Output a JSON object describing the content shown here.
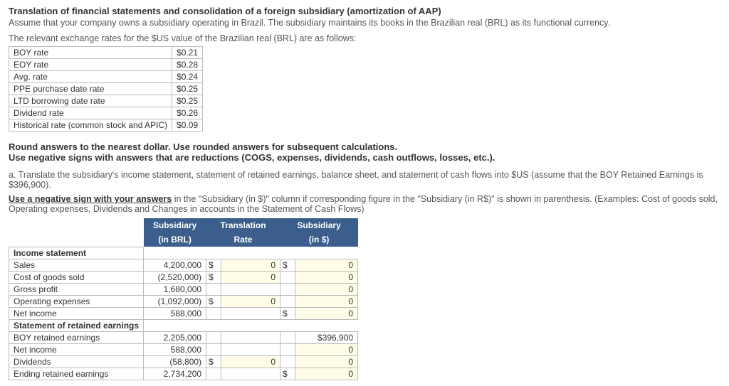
{
  "header": {
    "title": "Translation of financial statements and consolidation of a foreign subsidiary (amortization of AAP)",
    "intro": "Assume that your company owns a subsidiary operating in Brazil. The subsidiary maintains its books in the Brazilian real (BRL) as its functional currency.",
    "rates_lead": "The relevant exchange rates for the $US value of the Brazilian real (BRL) are as follows:"
  },
  "rates": [
    {
      "label": "BOY rate",
      "value": "$0.21"
    },
    {
      "label": "EOY rate",
      "value": "$0.28"
    },
    {
      "label": "Avg. rate",
      "value": "$0.24"
    },
    {
      "label": "PPE purchase date rate",
      "value": "$0.25"
    },
    {
      "label": "LTD borrowing date rate",
      "value": "$0.25"
    },
    {
      "label": "Dividend rate",
      "value": "$0.26"
    },
    {
      "label": "Historical rate (common stock and APIC)",
      "value": "$0.09"
    }
  ],
  "instructions": {
    "round": "Round answers to the nearest dollar. Use rounded answers for subsequent calculations.",
    "neg": "Use negative signs with answers that are reductions (COGS, expenses, dividends, cash outflows, losses, etc.).",
    "qa": "a. Translate the subsidiary's income statement, statement of retained earnings, balance sheet, and statement of cash flows into $US (assume that the BOY Retained Earnings is $396,900).",
    "neg2_pre": "Use a negative sign with your answers",
    "neg2_post": " in the \"Subsidiary (in $)\" column if corresponding figure in the \"Subsidiary (in R$)\" is shown in parenthesis. (Examples: Cost of goods sold, Operating expenses, Dividends and Changes in accounts in the Statement of Cash Flows)"
  },
  "ws": {
    "head": {
      "c1": "Subsidiary",
      "c1b": "(in BRL)",
      "c2": "Translation",
      "c2b": "Rate",
      "c3": "Subsidiary",
      "c3b": "(in $)"
    },
    "rows": [
      {
        "type": "section",
        "label": "Income statement"
      },
      {
        "type": "data",
        "label": "Sales",
        "brl": "4,200,000",
        "rcur": "$",
        "rate": "0",
        "dcur": "$",
        "usd": "0"
      },
      {
        "type": "data",
        "label": "Cost of goods sold",
        "brl": "(2,520,000)",
        "rcur": "$",
        "rate": "0",
        "dcur": "",
        "usd": "0"
      },
      {
        "type": "data",
        "label": "Gross profit",
        "brl": "1,680,000",
        "rcur": "",
        "rate": "",
        "dcur": "",
        "usd": "0"
      },
      {
        "type": "data",
        "label": "Operating expenses",
        "brl": "(1,092,000)",
        "rcur": "$",
        "rate": "0",
        "dcur": "",
        "usd": "0"
      },
      {
        "type": "data",
        "label": "Net income",
        "brl": "588,000",
        "rcur": "",
        "rate": "",
        "dcur": "$",
        "usd": "0"
      },
      {
        "type": "section",
        "label": "Statement of retained earnings"
      },
      {
        "type": "data",
        "label": "BOY retained earnings",
        "brl": "2,205,000",
        "rcur": "",
        "rate": "",
        "dcur": "",
        "usd": "$396,900"
      },
      {
        "type": "data",
        "label": "Net income",
        "brl": "588,000",
        "rcur": "",
        "rate": "",
        "dcur": "",
        "usd": "0"
      },
      {
        "type": "data",
        "label": "Dividends",
        "brl": "(58,800)",
        "rcur": "$",
        "rate": "0",
        "dcur": "",
        "usd": "0"
      },
      {
        "type": "data",
        "label": "Ending retained earnings",
        "brl": "2,734,200",
        "rcur": "",
        "rate": "",
        "dcur": "$",
        "usd": "0"
      }
    ]
  }
}
